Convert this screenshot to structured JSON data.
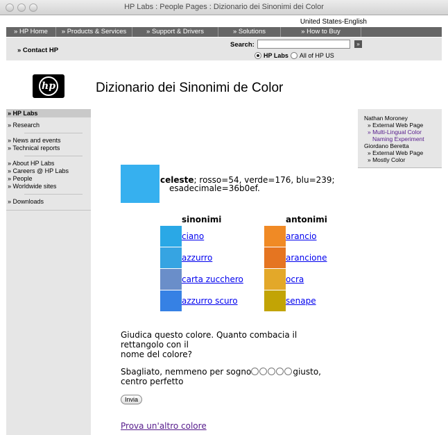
{
  "window": {
    "title": "HP Labs : People Pages : Dizionario dei Sinonimi dei Color"
  },
  "locale": "United States-English",
  "topnav": [
    {
      "label": "» HP Home"
    },
    {
      "label": "» Products & Services"
    },
    {
      "label": "» Support & Drivers"
    },
    {
      "label": "» Solutions"
    },
    {
      "label": "» How to Buy"
    }
  ],
  "band": {
    "contact": "» Contact HP",
    "search_label": "Search:",
    "search_value": "",
    "go_label": "»",
    "scope_hp_labs": "HP Labs",
    "scope_all": "All of HP US",
    "selected_scope": "HP Labs"
  },
  "logo": {
    "text": "hp"
  },
  "page_title": "Dizionario dei Sinonimi de Color",
  "sidebar": {
    "active": "» HP Labs",
    "groups": [
      [
        "» Research"
      ],
      [
        "» News and events",
        "» Technical reports"
      ],
      [
        "» About HP Labs",
        "» Careers @ HP Labs",
        "» People",
        "» Worldwide sites"
      ],
      [
        "» Downloads"
      ]
    ]
  },
  "rightbox": {
    "person1": "Nathan Moroney",
    "p1_link1": "» External Web Page",
    "p1_link2a": "» Multi-Lingual Color",
    "p1_link2b": "Naming Experiment",
    "person2": "Giordano Beretta",
    "p2_link1": "» External Web Page",
    "p2_link2": "» Mostly Color"
  },
  "color": {
    "name": "celeste",
    "sep": ";",
    "rgb_text": "rosso=54, verde=176, blu=239;",
    "hex_text": "esadecimale=36b0ef.",
    "hex": "#36b0ef"
  },
  "synonyms": {
    "header": "sinonimi",
    "items": [
      {
        "name": "ciano",
        "color": "#2aa8e6"
      },
      {
        "name": "azzurro",
        "color": "#36a4e2"
      },
      {
        "name": "carta zucchero",
        "color": "#6a8ec9"
      },
      {
        "name": "azzurro scuro",
        "color": "#3681e4"
      }
    ]
  },
  "antonyms": {
    "header": "antonimi",
    "items": [
      {
        "name": "arancio",
        "color": "#f08a25"
      },
      {
        "name": "arancione",
        "color": "#e57521"
      },
      {
        "name": "ocra",
        "color": "#e3a829"
      },
      {
        "name": "senape",
        "color": "#c2a405"
      }
    ]
  },
  "question": {
    "line1": "Giudica questo colore. Quanto combacia il",
    "line2": "rettangolo con il",
    "line3": "nome del colore?"
  },
  "rating": {
    "low": "Sbagliato, nemmeno per sogno",
    "high": "giusto,",
    "high2": "centro perfetto",
    "options": 5
  },
  "submit_label": "Invia",
  "try_other": "Prova un'altro colore"
}
